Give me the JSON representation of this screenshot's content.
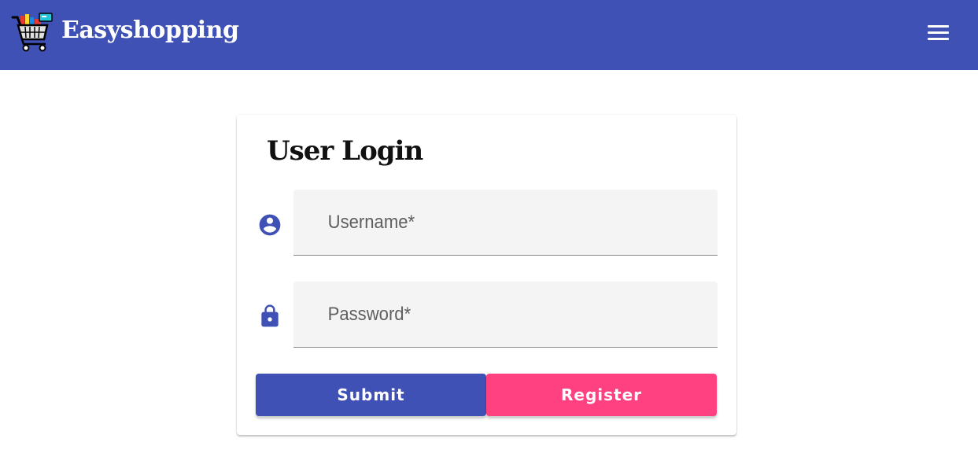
{
  "app": {
    "brand_name": "Easyshopping"
  },
  "header": {
    "menu_icon": "hamburger-menu-icon"
  },
  "login": {
    "title": "User Login",
    "username": {
      "icon": "account-circle-icon",
      "placeholder": "Username*",
      "value": ""
    },
    "password": {
      "icon": "lock-icon",
      "placeholder": "Password*",
      "value": ""
    },
    "submit_label": "Submit",
    "register_label": "Register"
  },
  "colors": {
    "primary": "#3f51b5",
    "accent": "#ff4081",
    "field_bg": "#f4f4f4"
  }
}
